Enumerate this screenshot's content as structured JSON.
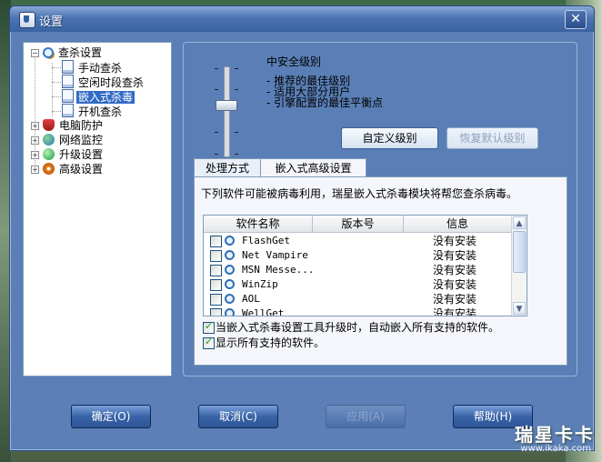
{
  "window": {
    "title": "设置",
    "close_glyph": "✕"
  },
  "tree": {
    "items": [
      {
        "label": "查杀设置",
        "icon": "magnifier-icon",
        "expander": "−"
      },
      {
        "label": "手动查杀",
        "icon": "document-icon"
      },
      {
        "label": "空闲时段查杀",
        "icon": "document-icon"
      },
      {
        "label": "嵌入式杀毒",
        "icon": "document-icon",
        "selected": true
      },
      {
        "label": "开机查杀",
        "icon": "document-icon"
      },
      {
        "label": "电脑防护",
        "icon": "shield-icon",
        "expander": "+"
      },
      {
        "label": "网络监控",
        "icon": "globe-icon",
        "expander": "+"
      },
      {
        "label": "升级设置",
        "icon": "upgrade-icon",
        "expander": "+"
      },
      {
        "label": "高级设置",
        "icon": "gear-icon",
        "expander": "+"
      }
    ]
  },
  "security_level": {
    "title": "中安全级别",
    "bullets": [
      "- 推荐的最佳级别",
      "- 适用大部分用户",
      "- 引擎配置的最佳平衡点"
    ],
    "custom_button": "自定义级别",
    "default_button": "恢复默认级别"
  },
  "tabs": [
    {
      "label": "处理方式",
      "active": false
    },
    {
      "label": "嵌入式高级设置",
      "active": true
    }
  ],
  "embedded": {
    "description": "下列软件可能被病毒利用，瑞星嵌入式杀毒模块将帮您查杀病毒。",
    "columns": [
      "软件名称",
      "版本号",
      "信息"
    ],
    "rows": [
      {
        "name": "FlashGet",
        "version": "",
        "info": "没有安装",
        "checked": false
      },
      {
        "name": "Net Vampire",
        "version": "",
        "info": "没有安装",
        "checked": false
      },
      {
        "name": "MSN Messe...",
        "version": "",
        "info": "没有安装",
        "checked": false
      },
      {
        "name": "WinZip",
        "version": "",
        "info": "没有安装",
        "checked": false
      },
      {
        "name": "AOL",
        "version": "",
        "info": "没有安装",
        "checked": false
      },
      {
        "name": "WellGet",
        "version": "",
        "info": "没有安装",
        "checked": false
      }
    ],
    "option_auto_embed": "当嵌入式杀毒设置工具升级时，自动嵌入所有支持的软件。",
    "option_show_all": "显示所有支持的软件。"
  },
  "footer": {
    "ok": "确定(O)",
    "cancel": "取消(C)",
    "apply": "应用(A)",
    "help": "帮助(H)"
  },
  "watermark": {
    "text": "瑞星卡卡",
    "url": "www.ikaka.com"
  },
  "colors": {
    "selection": "#316ac5",
    "window_frame": "#5b7fb6"
  }
}
